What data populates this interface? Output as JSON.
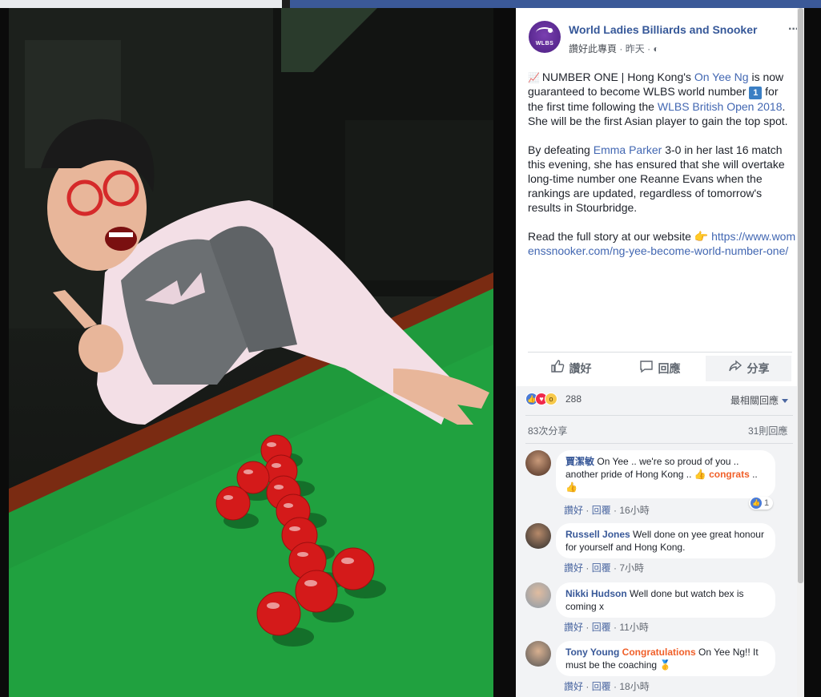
{
  "post": {
    "page_name": "World Ladies Billiards and Snooker",
    "avatar_text": "WLBS",
    "like_page": "讚好此專頁",
    "time": "昨天",
    "para1_emoji": "📈",
    "para1_a": "NUMBER ONE | Hong Kong's ",
    "para1_link1": "On Yee Ng",
    "para1_b": " is now guaranteed to become WLBS world number ",
    "para1_badge": "1",
    "para1_c": " for the first time following the ",
    "para1_link2": "WLBS British Open 2018",
    "para1_d": ". She will be the first Asian player to gain the top spot.",
    "para2_a": "By defeating ",
    "para2_link": "Emma Parker",
    "para2_b": " 3-0 in her last 16 match this evening, she has ensured that she will overtake long-time number one Reanne Evans when the rankings are updated, regardless of tomorrow's results in Stourbridge.",
    "para3_a": "Read the full story at our website 👉 ",
    "para3_link": "https://www.womenssnooker.com/ng-yee-become-world-number-one/"
  },
  "actions": {
    "like": "讚好",
    "comment": "回應",
    "share": "分享"
  },
  "reactions": {
    "count": "288",
    "sort": "最相關回應",
    "shares": "83次分享",
    "comments": "31則回應"
  },
  "comments": [
    {
      "name": "賈潔敏",
      "text_a": "On Yee .. we're so proud of you .. another pride of Hong Kong .. 👍",
      "highlight": "congrats",
      "text_b": " .. 👍",
      "like": "讚好",
      "reply": "回覆",
      "time": "16小時",
      "reacts": "1"
    },
    {
      "name": "Russell Jones",
      "text_a": "Well done on yee great honour for yourself and Hong Kong.",
      "like": "讚好",
      "reply": "回覆",
      "time": "7小時"
    },
    {
      "name": "Nikki Hudson",
      "text_a": "Well done but watch bex is coming x",
      "like": "讚好",
      "reply": "回覆",
      "time": "11小時"
    },
    {
      "name": "Tony Young",
      "highlight": "Congratulations",
      "text_b": " On Yee Ng!! It must be the coaching 🥇",
      "like": "讚好",
      "reply": "回覆",
      "time": "18小時"
    }
  ],
  "colors": {
    "link": "#4267b2",
    "name": "#365899",
    "felt": "#1f9a3c",
    "ball": "#d41a1a"
  }
}
